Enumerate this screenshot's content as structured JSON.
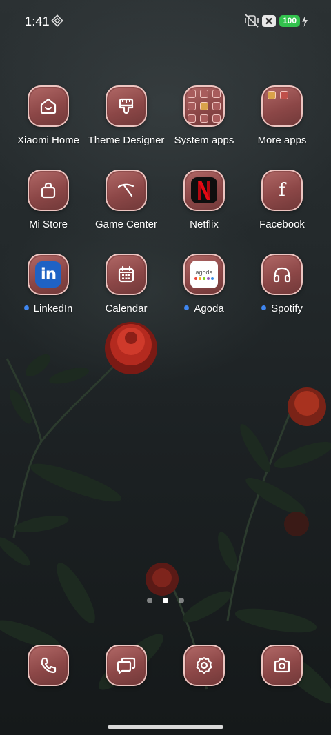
{
  "status_bar": {
    "time": "1:41",
    "battery_level": "100",
    "icons": [
      "sync-diamond-icon",
      "vibrate-off-icon",
      "no-sim-icon",
      "battery-icon",
      "charging-bolt-icon"
    ]
  },
  "apps": [
    {
      "label": "Xiaomi Home",
      "icon": "xiaomi-home-icon",
      "new": false
    },
    {
      "label": "Theme Designer",
      "icon": "paint-brush-icon",
      "new": false
    },
    {
      "label": "System apps",
      "icon": "folder-icon",
      "new": false
    },
    {
      "label": "More apps",
      "icon": "folder-icon",
      "new": false
    },
    {
      "label": "Mi Store",
      "icon": "shopping-bag-icon",
      "new": false
    },
    {
      "label": "Game Center",
      "icon": "game-center-icon",
      "new": false
    },
    {
      "label": "Netflix",
      "icon": "netflix-icon",
      "new": false
    },
    {
      "label": "Facebook",
      "icon": "facebook-icon",
      "new": false
    },
    {
      "label": "LinkedIn",
      "icon": "linkedin-icon",
      "new": true
    },
    {
      "label": "Calendar",
      "icon": "calendar-icon",
      "new": false
    },
    {
      "label": "Agoda",
      "icon": "agoda-icon",
      "new": true
    },
    {
      "label": "Spotify",
      "icon": "headphones-icon",
      "new": true
    }
  ],
  "linkedin_glyph": "in",
  "facebook_glyph": "f",
  "netflix_glyph": "N",
  "agoda_wordmark": "agoda",
  "agoda_dot_colors": [
    "#e8443a",
    "#f5a623",
    "#7ed321",
    "#9b59b6",
    "#3b8ee8"
  ],
  "page_indicator": {
    "pages": 3,
    "current": 2
  },
  "dock": [
    {
      "name": "phone",
      "icon": "phone-icon"
    },
    {
      "name": "messages",
      "icon": "messages-icon"
    },
    {
      "name": "settings",
      "icon": "gear-icon"
    },
    {
      "name": "camera",
      "icon": "camera-icon"
    }
  ],
  "colors": {
    "tile_top": "#b36a68",
    "tile_bottom": "#6f3838",
    "new_dot": "#3f86f0",
    "battery": "#32c24d"
  }
}
